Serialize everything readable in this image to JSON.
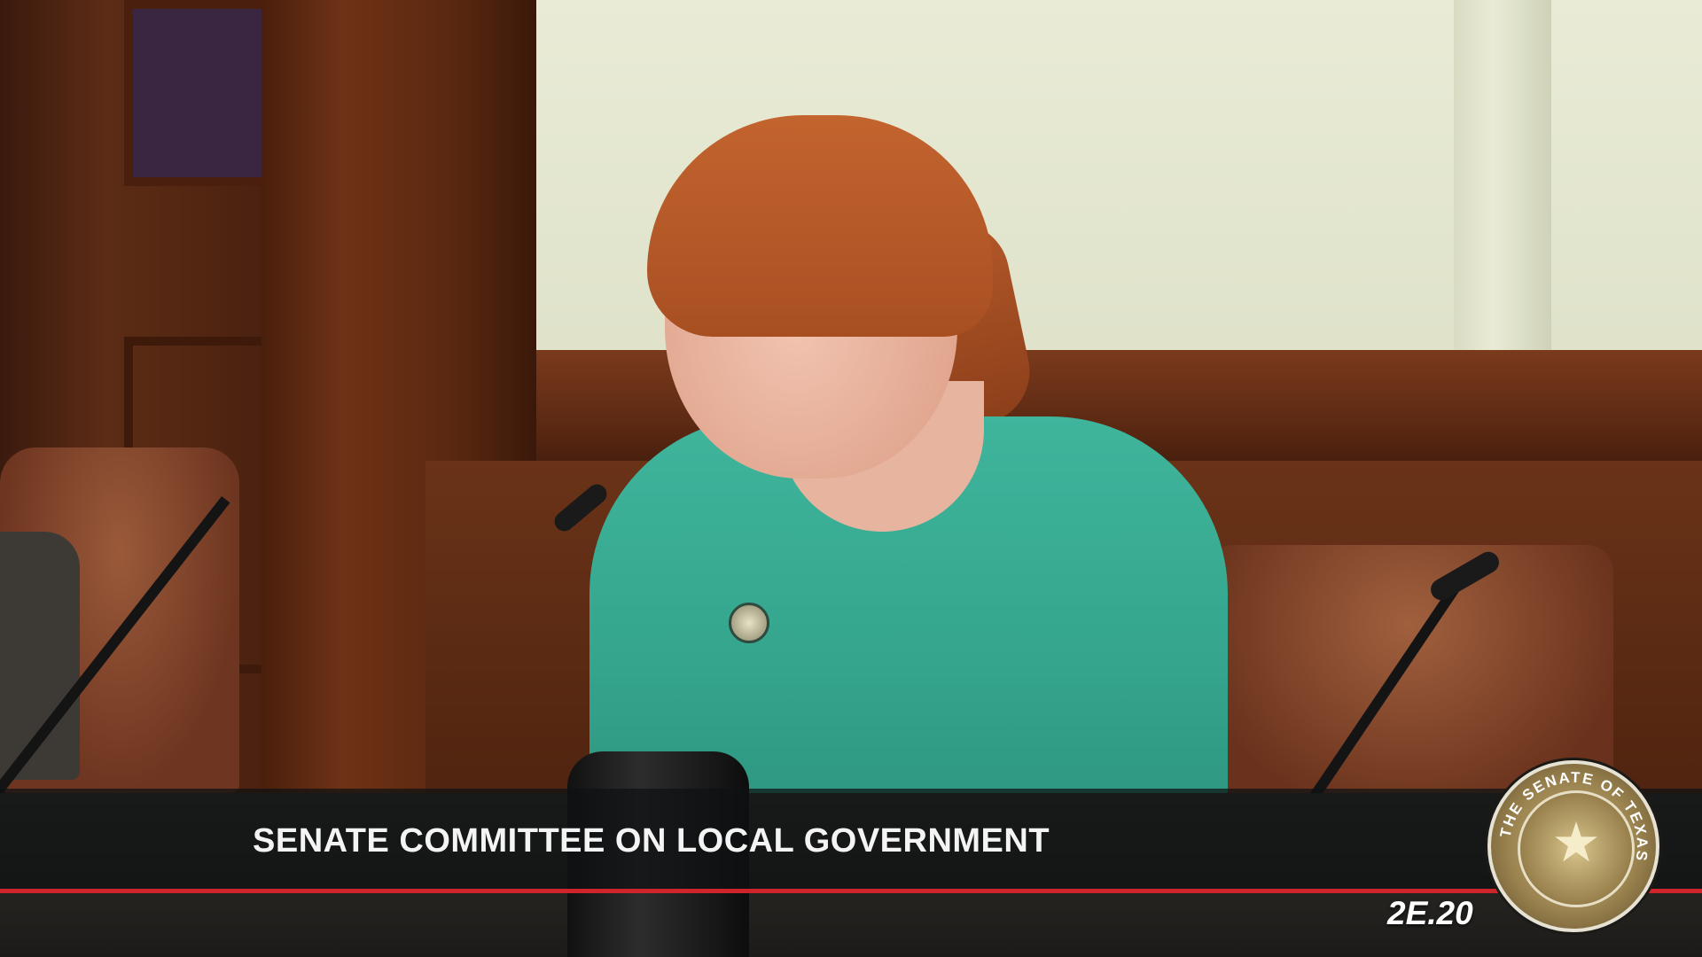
{
  "broadcast": {
    "title": "SENATE COMMITTEE ON LOCAL GOVERNMENT",
    "room_code": "2E.20",
    "seal_text": "THE SENATE OF TEXAS",
    "accent_color": "#d0242b"
  },
  "icons": {
    "seal": "senate-seal-icon",
    "star": "star-icon"
  }
}
